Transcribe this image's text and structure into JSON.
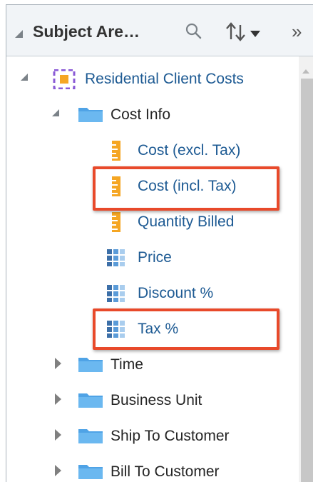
{
  "header": {
    "title": "Subject Are…",
    "collapse_icon": "collapse-triangle-icon",
    "search_icon": "search-icon",
    "sort_icon": "sort-icon",
    "more_icon": "overflow-chevrons-icon",
    "more_glyph": "»"
  },
  "tree": {
    "root": {
      "label": "Residential Client Costs",
      "icon": "subject-area-icon"
    },
    "folder_open": {
      "label": "Cost Info",
      "icon": "folder-icon"
    },
    "cost_info_items": [
      {
        "label": "Cost (excl. Tax)",
        "icon": "measure-ruler-icon",
        "highlighted": false
      },
      {
        "label": "Cost (incl. Tax)",
        "icon": "measure-ruler-icon",
        "highlighted": true
      },
      {
        "label": "Quantity Billed",
        "icon": "measure-ruler-icon",
        "highlighted": false
      },
      {
        "label": "Price",
        "icon": "attribute-grid-icon",
        "highlighted": false
      },
      {
        "label": "Discount %",
        "icon": "attribute-grid-icon",
        "highlighted": false
      },
      {
        "label": "Tax %",
        "icon": "attribute-grid-icon",
        "highlighted": true
      }
    ],
    "collapsed_folders": [
      {
        "label": "Time",
        "icon": "folder-icon"
      },
      {
        "label": "Business Unit",
        "icon": "folder-icon"
      },
      {
        "label": "Ship To Customer",
        "icon": "folder-icon"
      },
      {
        "label": "Bill To Customer",
        "icon": "folder-icon"
      }
    ]
  },
  "colors": {
    "link_blue": "#1d5a93",
    "highlight_orange": "#e8492a",
    "folder_blue": "#4fa3e6",
    "measure_orange": "#f5a623",
    "subject_purple": "#8a5ad6"
  }
}
